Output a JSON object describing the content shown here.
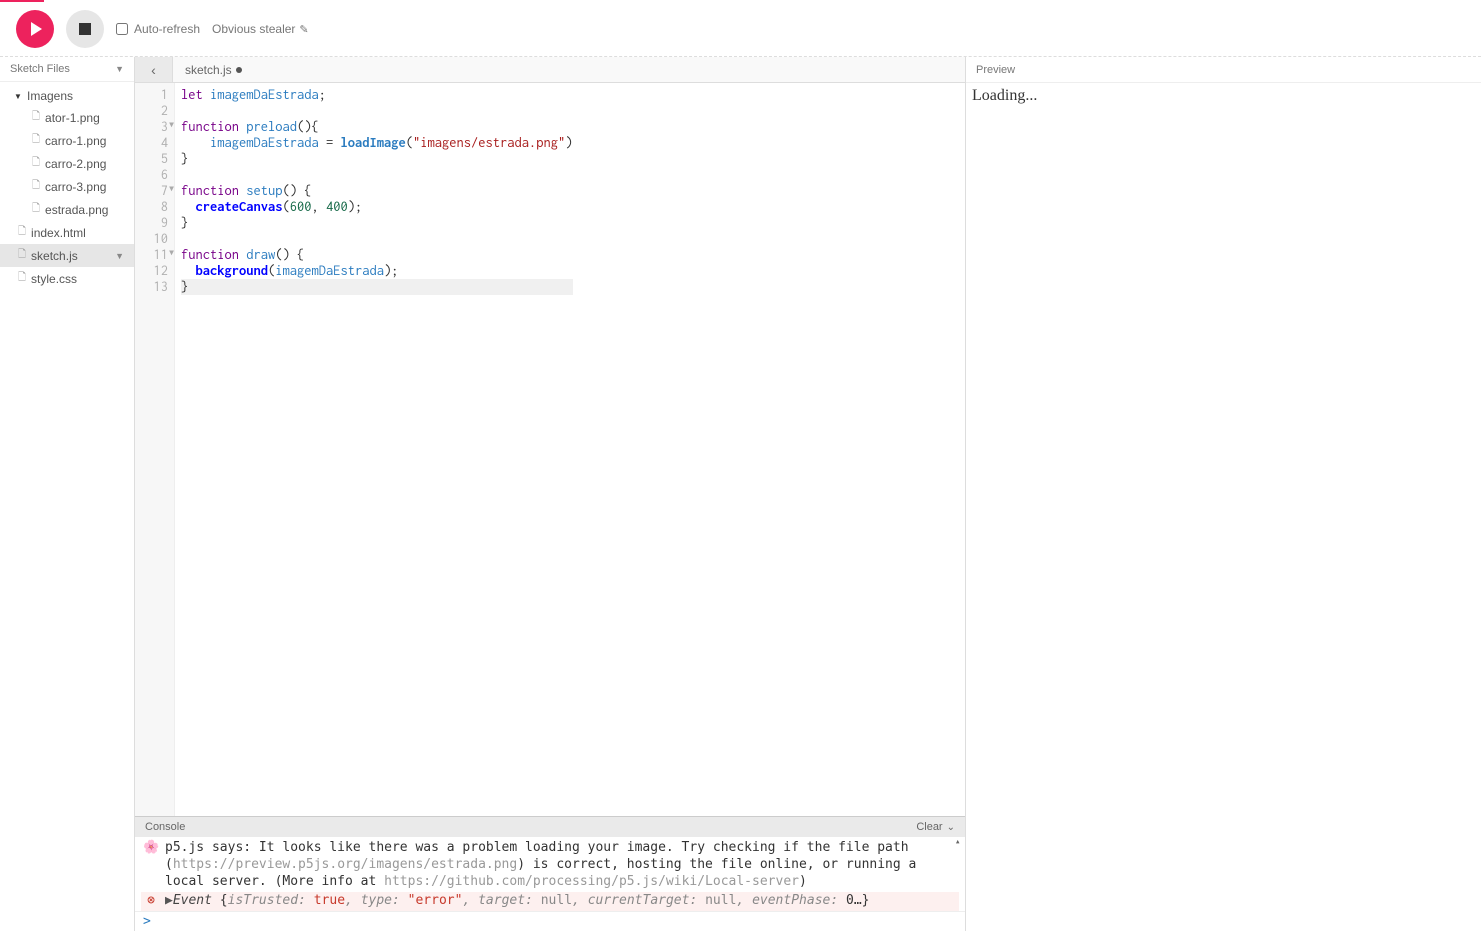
{
  "toolbar": {
    "auto_refresh_label": "Auto-refresh",
    "sketch_name": "Obvious stealer"
  },
  "sidebar": {
    "header": "Sketch Files",
    "folder": "Imagens",
    "files_in_folder": [
      "ator-1.png",
      "carro-1.png",
      "carro-2.png",
      "carro-3.png",
      "estrada.png"
    ],
    "root_files": [
      "index.html",
      "sketch.js",
      "style.css"
    ],
    "active_file": "sketch.js"
  },
  "tabs": {
    "active": "sketch.js"
  },
  "code": {
    "lines": [
      {
        "n": 1,
        "tokens": [
          {
            "t": "let ",
            "c": "kw"
          },
          {
            "t": "imagemDaEstrada",
            "c": "def"
          },
          {
            "t": ";",
            "c": "p"
          }
        ]
      },
      {
        "n": 2,
        "tokens": []
      },
      {
        "n": 3,
        "fold": true,
        "tokens": [
          {
            "t": "function ",
            "c": "kw"
          },
          {
            "t": "preload",
            "c": "def"
          },
          {
            "t": "(){",
            "c": "p"
          }
        ]
      },
      {
        "n": 4,
        "tokens": [
          {
            "t": "    ",
            "c": "p"
          },
          {
            "t": "imagemDaEstrada",
            "c": "var2"
          },
          {
            "t": " = ",
            "c": "p"
          },
          {
            "t": "loadImage",
            "c": "fn2"
          },
          {
            "t": "(",
            "c": "p"
          },
          {
            "t": "\"imagens/estrada.png\"",
            "c": "str"
          },
          {
            "t": ")",
            "c": "p"
          }
        ]
      },
      {
        "n": 5,
        "tokens": [
          {
            "t": "}",
            "c": "p"
          }
        ]
      },
      {
        "n": 6,
        "tokens": []
      },
      {
        "n": 7,
        "fold": true,
        "tokens": [
          {
            "t": "function ",
            "c": "kw"
          },
          {
            "t": "setup",
            "c": "def"
          },
          {
            "t": "() {",
            "c": "p"
          }
        ]
      },
      {
        "n": 8,
        "tokens": [
          {
            "t": "  ",
            "c": "p"
          },
          {
            "t": "createCanvas",
            "c": "fn"
          },
          {
            "t": "(",
            "c": "p"
          },
          {
            "t": "600",
            "c": "num"
          },
          {
            "t": ", ",
            "c": "p"
          },
          {
            "t": "400",
            "c": "num"
          },
          {
            "t": ");",
            "c": "p"
          }
        ]
      },
      {
        "n": 9,
        "tokens": [
          {
            "t": "}",
            "c": "p"
          }
        ]
      },
      {
        "n": 10,
        "tokens": []
      },
      {
        "n": 11,
        "fold": true,
        "tokens": [
          {
            "t": "function ",
            "c": "kw"
          },
          {
            "t": "draw",
            "c": "def"
          },
          {
            "t": "() {",
            "c": "p"
          }
        ]
      },
      {
        "n": 12,
        "tokens": [
          {
            "t": "  ",
            "c": "p"
          },
          {
            "t": "background",
            "c": "fn"
          },
          {
            "t": "(",
            "c": "p"
          },
          {
            "t": "imagemDaEstrada",
            "c": "var2"
          },
          {
            "t": ");",
            "c": "p"
          }
        ]
      },
      {
        "n": 13,
        "hl": true,
        "tokens": [
          {
            "t": "}",
            "c": "p"
          }
        ]
      }
    ]
  },
  "console": {
    "header": "Console",
    "clear": "Clear",
    "warn_text_1": "p5.js says: It looks like there was a problem loading your image. Try checking if the file path (",
    "warn_link_1": "https://preview.p5js.org/imagens/estrada.png",
    "warn_text_2": ") is correct, hosting the file online, or running a local server. (More info at ",
    "warn_link_2": "https://github.com/processing/p5.js/wiki/Local-server",
    "warn_text_3": ")",
    "err_prefix": "Event ",
    "err_brace_open": "{",
    "err_k1": "isTrusted: ",
    "err_v1": "true",
    "err_k2": "type: ",
    "err_v2": "\"error\"",
    "err_k3": "target: ",
    "err_v3": "null",
    "err_k4": "currentTarget: ",
    "err_v4": "null",
    "err_k5": "eventPhase: ",
    "err_v5": "0…",
    "err_brace_close": "}",
    "prompt": ">"
  },
  "preview": {
    "header": "Preview",
    "body": "Loading..."
  }
}
